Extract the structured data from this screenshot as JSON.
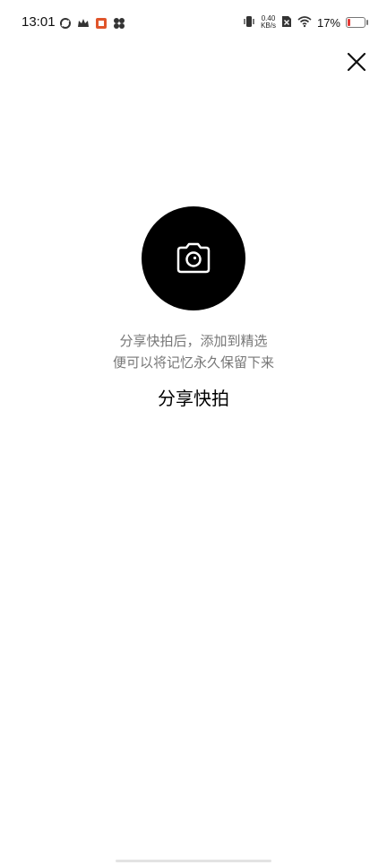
{
  "status_bar": {
    "time": "13:01",
    "left_icons": [
      "sync-icon",
      "crown-icon",
      "app-badge-icon",
      "flower-icon"
    ],
    "right_icons": [
      "vibrate-icon",
      "sim-x-icon",
      "wifi-icon"
    ],
    "net_speed_value": "0.40",
    "net_speed_unit": "KB/s",
    "battery_percent": "17%",
    "battery_level": 0.17,
    "battery_color": "#e53935"
  },
  "header": {
    "close_icon": "close-icon"
  },
  "main": {
    "icon": "camera-icon",
    "description_line1": "分享快拍后，添加到精选",
    "description_line2": "便可以将记忆永久保留下来",
    "button_label": "分享快拍"
  },
  "colors": {
    "background": "#ffffff",
    "circle": "#000000",
    "description_text": "#777777",
    "button_text": "#000000"
  }
}
